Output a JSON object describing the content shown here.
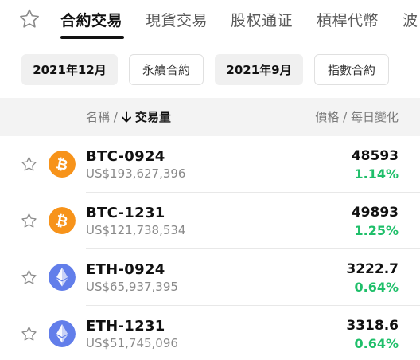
{
  "tabs": {
    "items": [
      {
        "label": "合約交易",
        "active": true
      },
      {
        "label": "現貨交易",
        "active": false
      },
      {
        "label": "股权通证",
        "active": false
      },
      {
        "label": "槓桿代幣",
        "active": false
      },
      {
        "label": "波",
        "active": false
      }
    ]
  },
  "filters": [
    {
      "label": "2021年12月",
      "selected": true
    },
    {
      "label": "永續合約",
      "selected": false
    },
    {
      "label": "2021年9月",
      "selected": true
    },
    {
      "label": "指數合約",
      "selected": false
    }
  ],
  "header": {
    "name_label": "名稱 /",
    "sort_label": "交易量",
    "price_label": "價格 / 每日變化"
  },
  "rows": [
    {
      "symbol": "BTC-0924",
      "volume": "US$193,627,396",
      "price": "48593",
      "change": "1.14%",
      "coin": "bitcoin-icon"
    },
    {
      "symbol": "BTC-1231",
      "volume": "US$121,738,534",
      "price": "49893",
      "change": "1.25%",
      "coin": "bitcoin-icon"
    },
    {
      "symbol": "ETH-0924",
      "volume": "US$65,937,395",
      "price": "3222.7",
      "change": "0.64%",
      "coin": "ethereum-icon"
    },
    {
      "symbol": "ETH-1231",
      "volume": "US$51,745,096",
      "price": "3318.6",
      "change": "0.64%",
      "coin": "ethereum-icon"
    }
  ],
  "colors": {
    "positive": "#1fbf6a",
    "bitcoin": "#f7931a",
    "ethereum": "#627eea"
  }
}
